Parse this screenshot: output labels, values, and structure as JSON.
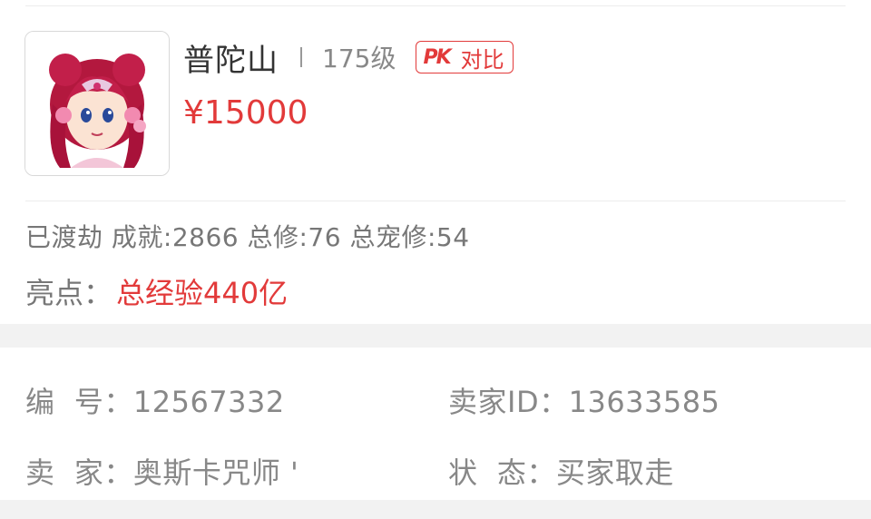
{
  "listing": {
    "school": "普陀山",
    "level": "175级",
    "pk_compare": {
      "icon_text": "PK",
      "label": "对比"
    },
    "price": "¥15000",
    "summary": "已渡劫 成就:2866 总修:76 总宠修:54",
    "highlight": {
      "label": "亮点：",
      "value": "总经验440亿"
    }
  },
  "details": {
    "id_label": "编  号：",
    "id_value": "12567332",
    "seller_id_label": "卖家ID：",
    "seller_id_value": "13633585",
    "seller_label": "卖  家：",
    "seller_value": "奥斯卡咒师 '",
    "status_label": "状  态：",
    "status_value": "买家取走"
  },
  "colors": {
    "accent_red": "#e23a3a",
    "text_gray": "#888888",
    "band_gray": "#f2f2f2"
  },
  "icons": {
    "avatar": "character-portrait-icon",
    "pk": "pk-compare-icon"
  }
}
